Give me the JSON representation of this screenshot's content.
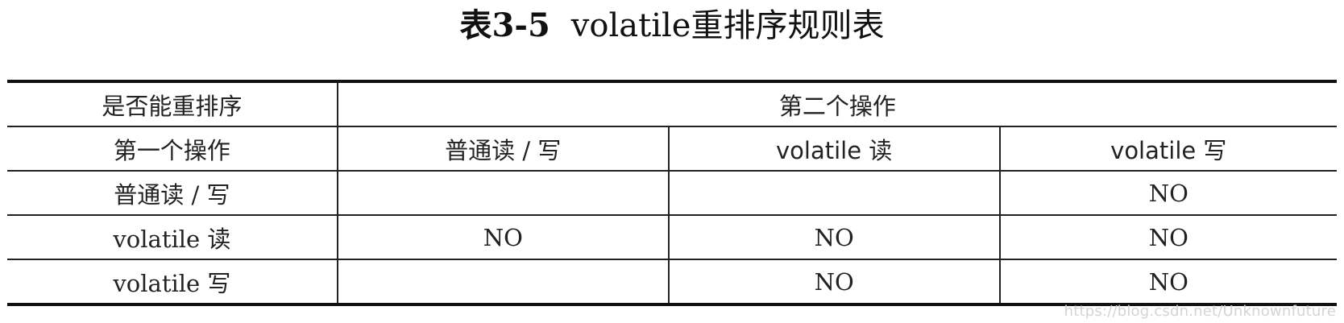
{
  "caption": {
    "label": "表3-5",
    "title": "volatile重排序规则表"
  },
  "table": {
    "corner_label": "是否能重排序",
    "second_op_header": "第二个操作",
    "first_op_header": "第一个操作",
    "columns": [
      "普通读 / 写",
      "volatile 读",
      "volatile 写"
    ],
    "rows": [
      {
        "label": "普通读 / 写",
        "cells": [
          "",
          "",
          "NO"
        ]
      },
      {
        "label": "volatile 读",
        "cells": [
          "NO",
          "NO",
          "NO"
        ]
      },
      {
        "label": "volatile 写",
        "cells": [
          "",
          "NO",
          "NO"
        ]
      }
    ]
  },
  "watermark": "https://blog.csdn.net/Unknownfuture"
}
